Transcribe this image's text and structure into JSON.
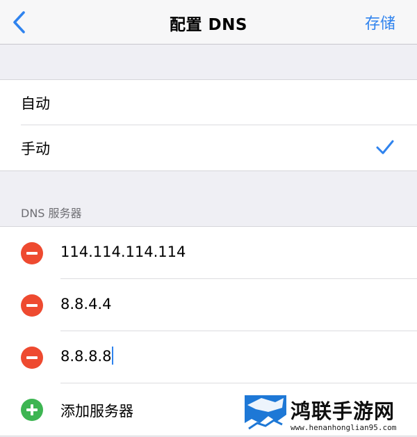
{
  "navbar": {
    "title": "配置 DNS",
    "save_label": "存储",
    "back_icon": "chevron-left-icon"
  },
  "mode": {
    "options": [
      {
        "label": "自动",
        "selected": false
      },
      {
        "label": "手动",
        "selected": true
      }
    ]
  },
  "dns_section": {
    "header": "DNS 服务器",
    "servers": [
      "114.114.114.114",
      "8.8.4.4",
      "8.8.8.8"
    ],
    "add_label": "添加服务器"
  },
  "watermark": {
    "name": "鸿联手游网",
    "url": "www.henanhonglian95.com"
  },
  "colors": {
    "accent": "#2f83ee",
    "delete": "#ee4a30",
    "add": "#3db552",
    "background": "#efeff4"
  }
}
